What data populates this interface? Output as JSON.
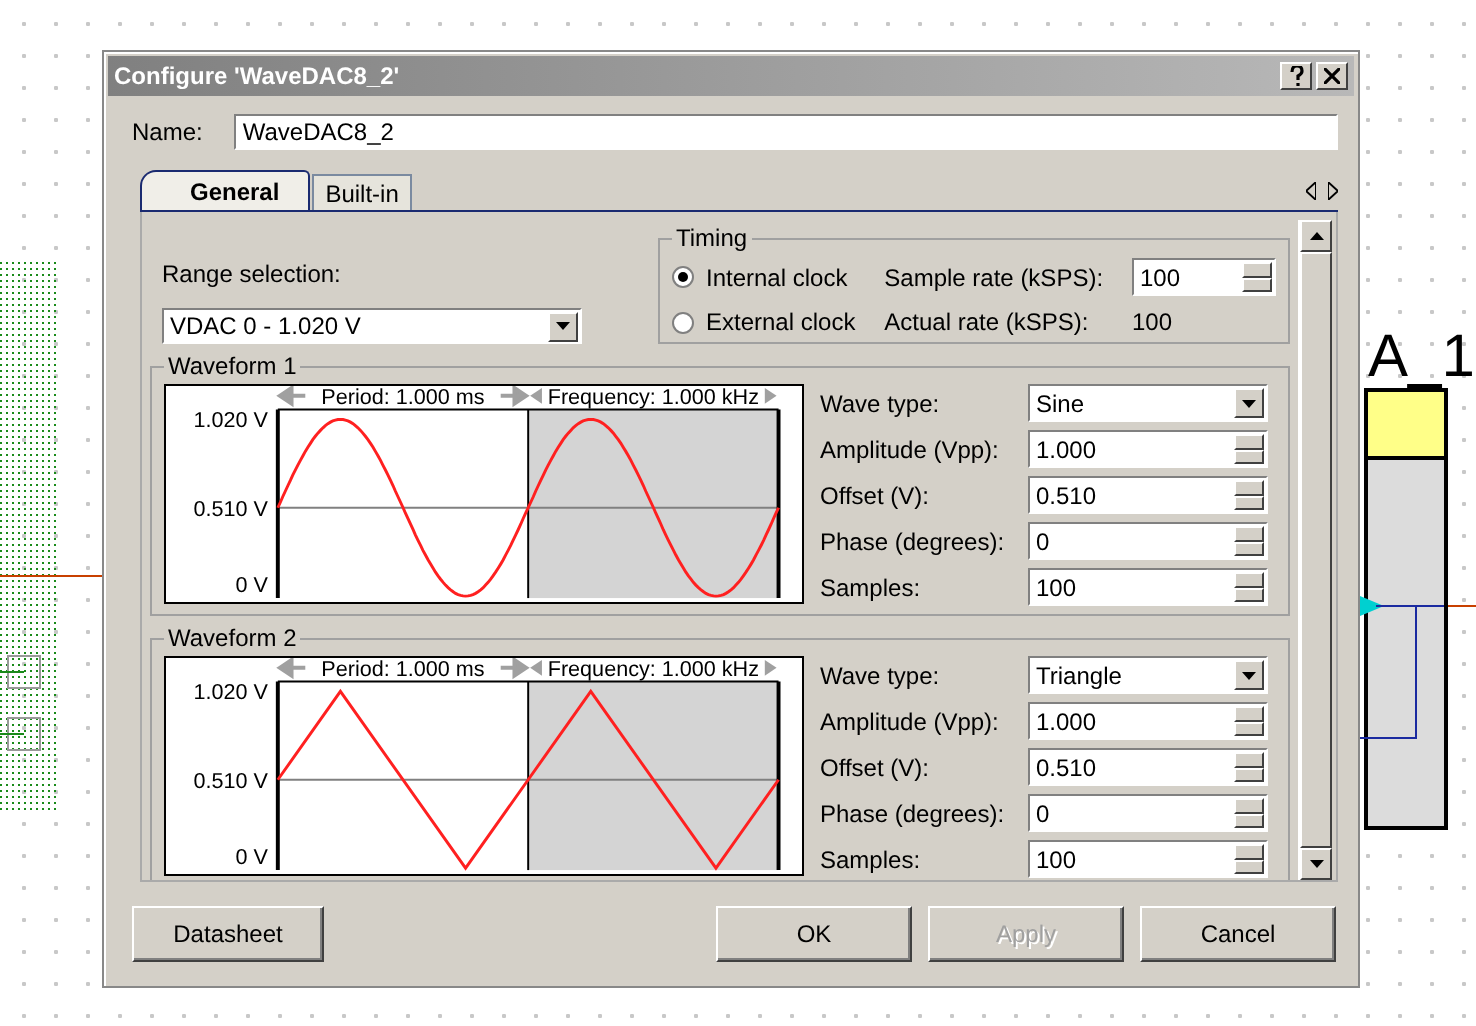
{
  "window": {
    "title": "Configure 'WaveDAC8_2'"
  },
  "name_field": {
    "label": "Name:",
    "value": "WaveDAC8_2"
  },
  "tabs": [
    {
      "label": "General",
      "selected": true
    },
    {
      "label": "Built-in",
      "selected": false
    }
  ],
  "range_selection": {
    "label": "Range selection:",
    "value": "VDAC 0 - 1.020 V"
  },
  "timing": {
    "title": "Timing",
    "clock_options": [
      {
        "label": "Internal clock",
        "selected": true
      },
      {
        "label": "External clock",
        "selected": false
      }
    ],
    "sample_rate": {
      "label": "Sample rate (kSPS):",
      "value": "100"
    },
    "actual_rate": {
      "label": "Actual rate (kSPS):",
      "value": "100"
    }
  },
  "waveforms": [
    {
      "title": "Waveform 1",
      "kind": "sine",
      "period": "Period: 1.000 ms",
      "frequency": "Frequency: 1.000 kHz",
      "y_labels": [
        "1.020 V",
        "0.510 V",
        "0 V"
      ],
      "fields": [
        {
          "label": "Wave type:",
          "value": "Sine",
          "kind": "dropdown"
        },
        {
          "label": "Amplitude (Vpp):",
          "value": "1.000",
          "kind": "spin"
        },
        {
          "label": "Offset (V):",
          "value": "0.510",
          "kind": "spin"
        },
        {
          "label": "Phase (degrees):",
          "value": "0",
          "kind": "spin"
        },
        {
          "label": "Samples:",
          "value": "100",
          "kind": "spin"
        }
      ]
    },
    {
      "title": "Waveform 2",
      "kind": "triangle",
      "period": "Period: 1.000 ms",
      "frequency": "Frequency: 1.000 kHz",
      "y_labels": [
        "1.020 V",
        "0.510 V",
        "0 V"
      ],
      "fields": [
        {
          "label": "Wave type:",
          "value": "Triangle",
          "kind": "dropdown"
        },
        {
          "label": "Amplitude (Vpp):",
          "value": "1.000",
          "kind": "spin"
        },
        {
          "label": "Offset (V):",
          "value": "0.510",
          "kind": "spin"
        },
        {
          "label": "Phase (degrees):",
          "value": "0",
          "kind": "spin"
        },
        {
          "label": "Samples:",
          "value": "100",
          "kind": "spin"
        }
      ]
    }
  ],
  "buttons": [
    {
      "label": "Datasheet",
      "disabled": false
    },
    {
      "label": "OK",
      "disabled": false
    },
    {
      "label": "Apply",
      "disabled": true
    },
    {
      "label": "Cancel",
      "disabled": false
    }
  ],
  "schematic": {
    "label": "A_1"
  }
}
